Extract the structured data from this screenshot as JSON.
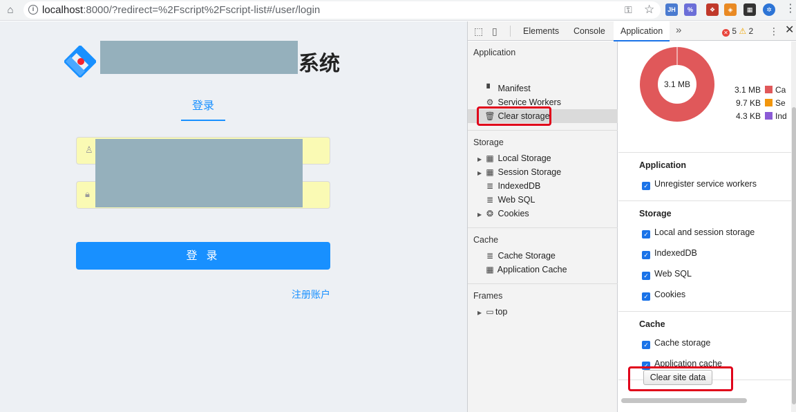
{
  "browser": {
    "url_host": "localhost",
    "url_rest": ":8000/?redirect=%2Fscript%2Fscript-list#/user/login",
    "extensions": [
      {
        "label": "JH",
        "color": "#4a7bd0"
      },
      {
        "label": "%",
        "color": "#6b6fd8"
      },
      {
        "label": "❖",
        "color": "#c0392b"
      },
      {
        "label": "◈",
        "color": "#e98a24"
      },
      {
        "label": "▦",
        "color": "#333333"
      },
      {
        "label": "✲",
        "color": "#2c74d6"
      }
    ]
  },
  "login": {
    "title_suffix": "系统",
    "tab_label": "登录",
    "submit_label": "登 录",
    "register_link": "注册账户",
    "username_placeholder": "",
    "password_placeholder": ""
  },
  "devtools": {
    "tabs": [
      "Elements",
      "Console",
      "Application"
    ],
    "active_tab": "Application",
    "more_tabs": "»",
    "error_count": "5",
    "warning_count": "2",
    "sidebar": {
      "application_header": "Application",
      "application_items": [
        "Manifest",
        "Service Workers",
        "Clear storage"
      ],
      "storage_header": "Storage",
      "storage_items": [
        "Local Storage",
        "Session Storage",
        "IndexedDB",
        "Web SQL",
        "Cookies"
      ],
      "cache_header": "Cache",
      "cache_items": [
        "Cache Storage",
        "Application Cache"
      ],
      "frames_header": "Frames",
      "frames_items": [
        "top"
      ]
    },
    "usage": {
      "total": "3.1 MB",
      "legend": [
        {
          "size": "3.1 MB",
          "label": "Ca",
          "color": "#e0585a"
        },
        {
          "size": "9.7 KB",
          "label": "Se",
          "color": "#f2960c"
        },
        {
          "size": "4.3 KB",
          "label": "Ind",
          "color": "#8b5bd6"
        }
      ]
    },
    "clear_panel": {
      "application_header": "Application",
      "application_checks": [
        "Unregister service workers"
      ],
      "storage_header": "Storage",
      "storage_checks": [
        "Local and session storage",
        "IndexedDB",
        "Web SQL",
        "Cookies"
      ],
      "cache_header": "Cache",
      "cache_checks": [
        "Cache storage",
        "Application cache"
      ],
      "clear_button": "Clear site data"
    }
  }
}
